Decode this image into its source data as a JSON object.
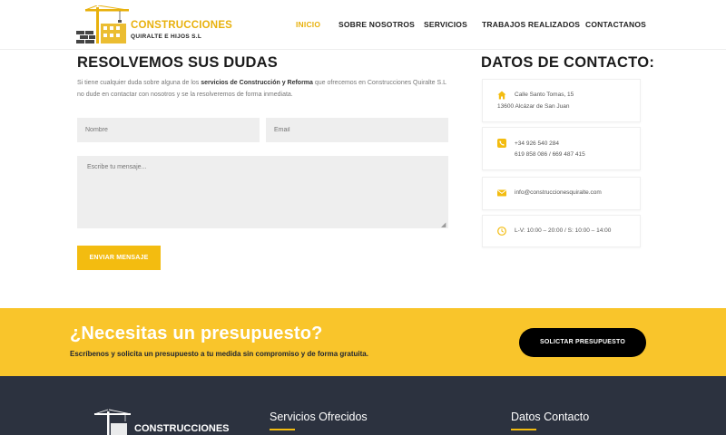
{
  "brand": {
    "name_line1": "CONSTRUCCIONES",
    "name_line2": "QUIRALTE E HIJOS S.L",
    "accent": "#f3bc10"
  },
  "nav": {
    "items": [
      {
        "label": "INICIO",
        "active": true
      },
      {
        "label": "SOBRE NOSOTROS",
        "active": false
      },
      {
        "label": "SERVICIOS",
        "active": false
      },
      {
        "label": "TRABAJOS REALIZADOS",
        "active": false
      },
      {
        "label": "CONTACTANOS",
        "active": false
      }
    ]
  },
  "form": {
    "title": "RESOLVEMOS SUS DUDAS",
    "intro_1": "Si tiene cualquier duda sobre alguna de los ",
    "intro_bold": "servicios de Construcción y Reforma",
    "intro_2": " que ofrecemos en Construcciones Quiralte S.L no dude en contactar con nosotros y se la resolveremos de forma inmediata.",
    "name_placeholder": "Nombre",
    "email_placeholder": "Email",
    "message_placeholder": "Escribe tu mensaje...",
    "submit_label": "ENVIAR MENSAJE"
  },
  "contact": {
    "title": "DATOS DE CONTACTO:",
    "address_line1": "Calle Santo Tomas, 15",
    "address_line2": "13600 Alcázar de San Juan",
    "phone_line1": "+34 926 540 284",
    "phone_line2": "619 858 086 / 669 487 415",
    "email": "info@construccionesquiralte.com",
    "hours": "L-V: 10:00 – 20:00 / S: 10:00 – 14:00",
    "icon_names": [
      "home-icon",
      "phone-icon",
      "envelope-icon",
      "clock-icon"
    ]
  },
  "cta": {
    "title": "¿Necesitas un presupuesto?",
    "subtitle": "Escríbenos y solicita un presupuesto a tu medida sin compromiso y de forma gratuita.",
    "button_label": "SOLICTAR PRESUPUESTO",
    "background": "#f9c52b"
  },
  "footer": {
    "logo_text": "CONSTRUCCIONES",
    "heading_services": "Servicios Ofrecidos",
    "heading_contact": "Datos Contacto",
    "background": "#2c323f"
  }
}
